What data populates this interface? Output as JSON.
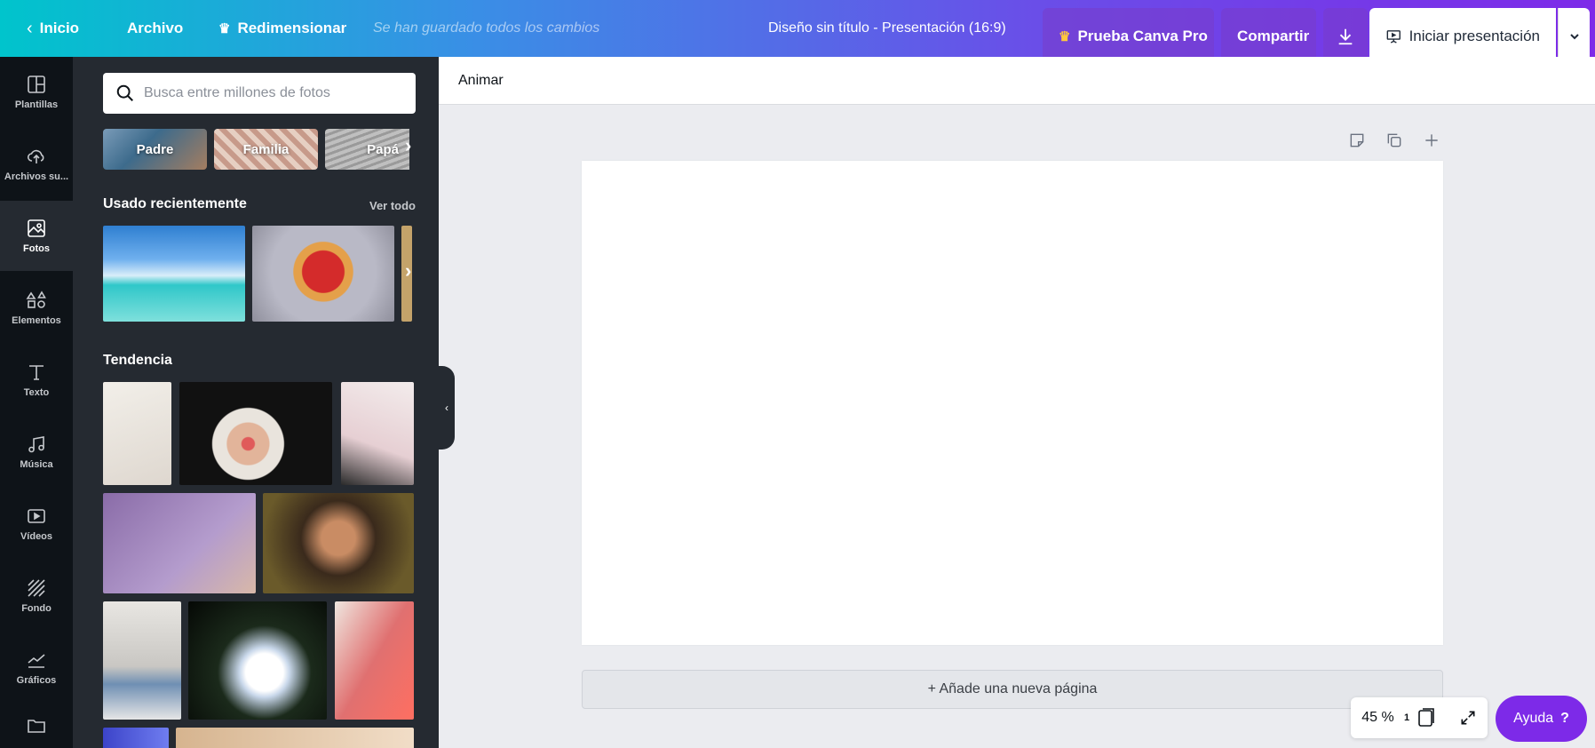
{
  "topbar": {
    "home_label": "Inicio",
    "file_label": "Archivo",
    "resize_label": "Redimensionar",
    "saved_status": "Se han guardado todos los cambios",
    "design_title": "Diseño sin título - Presentación (16:9)",
    "pro_label": "Prueba Canva Pro",
    "share_label": "Compartir",
    "present_label": "Iniciar presentación"
  },
  "rail": {
    "items": [
      {
        "label": "Plantillas",
        "icon": "templates-icon"
      },
      {
        "label": "Archivos su...",
        "icon": "upload-cloud-icon"
      },
      {
        "label": "Fotos",
        "icon": "photos-icon"
      },
      {
        "label": "Elementos",
        "icon": "elements-icon"
      },
      {
        "label": "Texto",
        "icon": "text-icon"
      },
      {
        "label": "Música",
        "icon": "music-icon"
      },
      {
        "label": "Vídeos",
        "icon": "video-icon"
      },
      {
        "label": "Fondo",
        "icon": "background-icon"
      },
      {
        "label": "Gráficos",
        "icon": "charts-icon"
      },
      {
        "label": "",
        "icon": "folder-icon"
      }
    ]
  },
  "panel": {
    "search_placeholder": "Busca entre millones de fotos",
    "chips": [
      "Padre",
      "Familia",
      "Papá"
    ],
    "recent_title": "Usado recientemente",
    "see_all": "Ver todo",
    "trending_title": "Tendencia"
  },
  "editor": {
    "animate_label": "Animar",
    "add_page_label": "+ Añade una nueva página",
    "zoom_value": "45 %",
    "page_count": "1",
    "help_label": "Ayuda",
    "help_icon": "?"
  },
  "colors": {
    "accent": "#7d2ae8",
    "gradient_start": "#00c4cc",
    "panel_bg": "#252a31",
    "rail_bg": "#0e1318"
  }
}
